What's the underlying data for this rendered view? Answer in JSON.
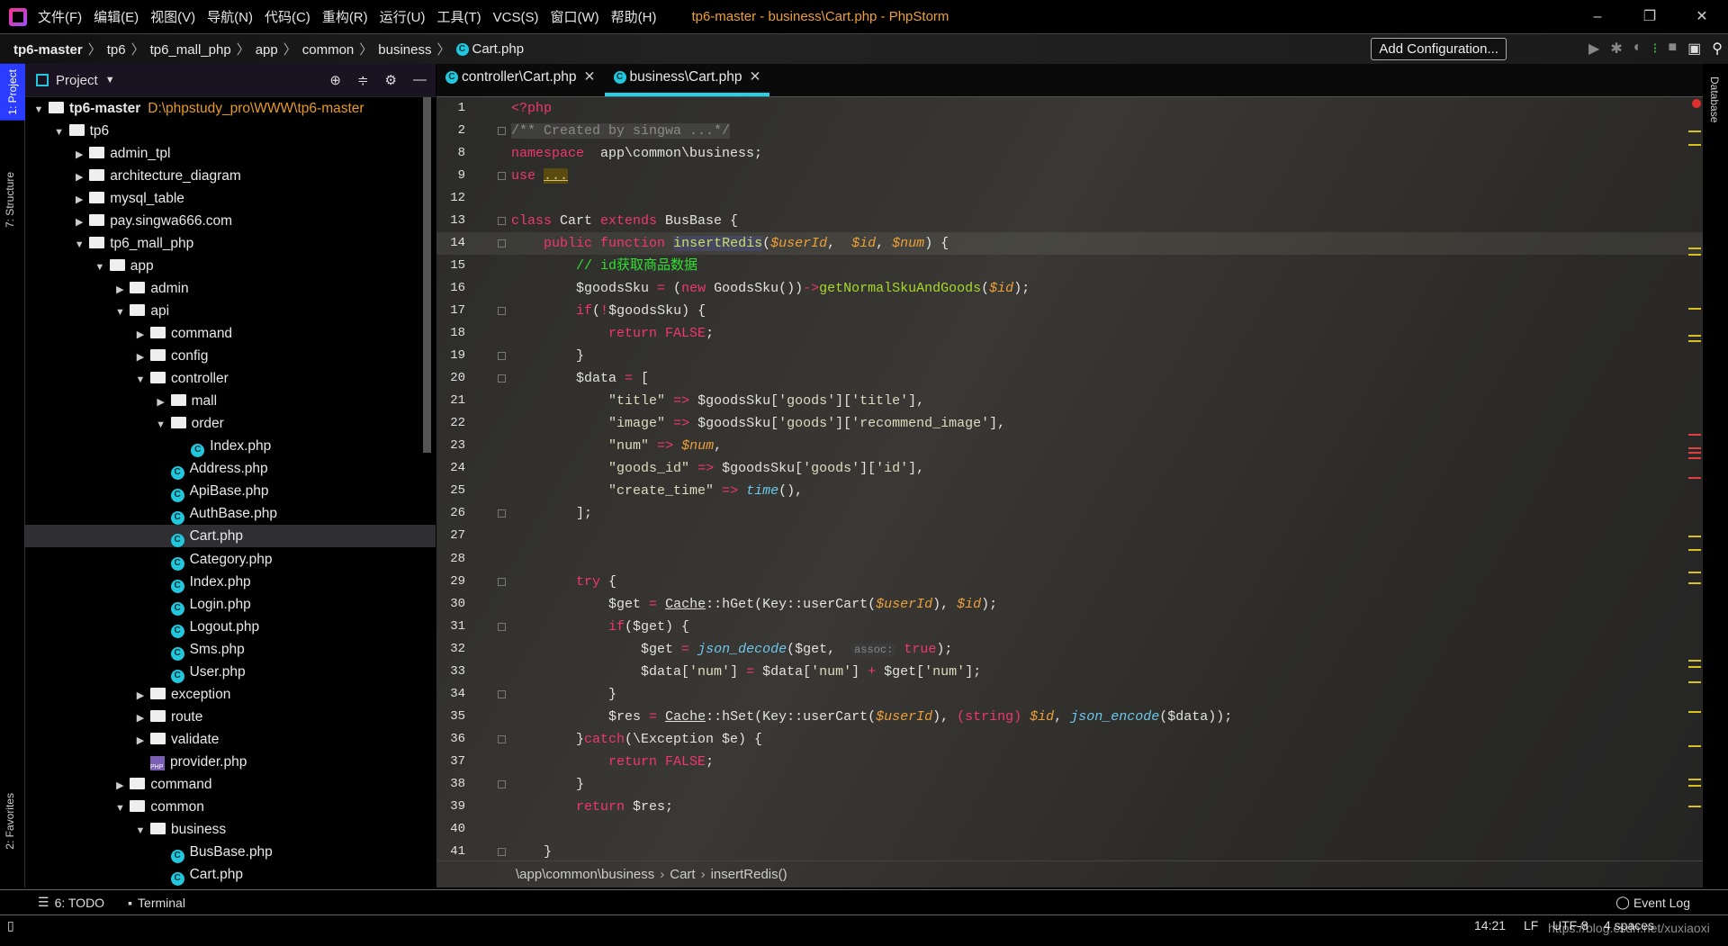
{
  "titlebar": {
    "menu": [
      "文件(F)",
      "编辑(E)",
      "视图(V)",
      "导航(N)",
      "代码(C)",
      "重构(R)",
      "运行(U)",
      "工具(T)",
      "VCS(S)",
      "窗口(W)",
      "帮助(H)"
    ],
    "title": "tp6-master - business\\Cart.php - PhpStorm"
  },
  "navbar": {
    "crumbs": [
      "tp6-master",
      "tp6",
      "tp6_mall_php",
      "app",
      "common",
      "business"
    ],
    "file": "Cart.php",
    "add_config": "Add Configuration..."
  },
  "side_tabs": {
    "project": "1: Project",
    "structure": "7: Structure",
    "favorites": "2: Favorites",
    "database": "Database"
  },
  "project": {
    "title": "Project",
    "root_path": "D:\\phpstudy_pro\\WWW\\tp6-master",
    "tree": [
      {
        "d": 0,
        "t": "folder",
        "open": true,
        "label": "tp6-master",
        "bold": true
      },
      {
        "d": 1,
        "t": "folder",
        "open": true,
        "label": "tp6"
      },
      {
        "d": 2,
        "t": "folder",
        "open": false,
        "label": "admin_tpl"
      },
      {
        "d": 2,
        "t": "folder",
        "open": false,
        "label": "architecture_diagram"
      },
      {
        "d": 2,
        "t": "folder",
        "open": false,
        "label": "mysql_table"
      },
      {
        "d": 2,
        "t": "folder",
        "open": false,
        "label": "pay.singwa666.com"
      },
      {
        "d": 2,
        "t": "folder",
        "open": true,
        "label": "tp6_mall_php"
      },
      {
        "d": 3,
        "t": "folder",
        "open": true,
        "label": "app"
      },
      {
        "d": 4,
        "t": "folder",
        "open": false,
        "label": "admin"
      },
      {
        "d": 4,
        "t": "folder",
        "open": true,
        "label": "api"
      },
      {
        "d": 5,
        "t": "folder",
        "open": false,
        "label": "command"
      },
      {
        "d": 5,
        "t": "folder",
        "open": false,
        "label": "config"
      },
      {
        "d": 5,
        "t": "folder",
        "open": true,
        "label": "controller"
      },
      {
        "d": 6,
        "t": "folder",
        "open": false,
        "label": "mall"
      },
      {
        "d": 6,
        "t": "folder",
        "open": true,
        "label": "order"
      },
      {
        "d": 7,
        "t": "class",
        "label": "Index.php"
      },
      {
        "d": 6,
        "t": "class",
        "label": "Address.php"
      },
      {
        "d": 6,
        "t": "class",
        "label": "ApiBase.php"
      },
      {
        "d": 6,
        "t": "class",
        "label": "AuthBase.php"
      },
      {
        "d": 6,
        "t": "class",
        "label": "Cart.php",
        "selected": true
      },
      {
        "d": 6,
        "t": "class",
        "label": "Category.php"
      },
      {
        "d": 6,
        "t": "class",
        "label": "Index.php"
      },
      {
        "d": 6,
        "t": "class",
        "label": "Login.php"
      },
      {
        "d": 6,
        "t": "class",
        "label": "Logout.php"
      },
      {
        "d": 6,
        "t": "class",
        "label": "Sms.php"
      },
      {
        "d": 6,
        "t": "class",
        "label": "User.php"
      },
      {
        "d": 5,
        "t": "folder",
        "open": false,
        "label": "exception"
      },
      {
        "d": 5,
        "t": "folder",
        "open": false,
        "label": "route"
      },
      {
        "d": 5,
        "t": "folder",
        "open": false,
        "label": "validate"
      },
      {
        "d": 5,
        "t": "php",
        "label": "provider.php"
      },
      {
        "d": 4,
        "t": "folder",
        "open": false,
        "label": "command"
      },
      {
        "d": 4,
        "t": "folder",
        "open": true,
        "label": "common"
      },
      {
        "d": 5,
        "t": "folder",
        "open": true,
        "label": "business"
      },
      {
        "d": 6,
        "t": "class",
        "label": "BusBase.php"
      },
      {
        "d": 6,
        "t": "class",
        "label": "Cart.php"
      }
    ]
  },
  "editor": {
    "tabs": [
      {
        "label": "controller\\Cart.php",
        "active": false
      },
      {
        "label": "business\\Cart.php",
        "active": true
      }
    ],
    "current_line": 14,
    "lines": [
      {
        "n": 1,
        "tk": [
          [
            "kw",
            "<?php"
          ]
        ]
      },
      {
        "n": 2,
        "tk": [
          [
            "doc",
            "/** Created by singwa ...*/"
          ]
        ]
      },
      {
        "n": 8,
        "tk": [
          [
            "kw",
            "namespace"
          ],
          [
            "",
            "  app\\common\\business;"
          ]
        ]
      },
      {
        "n": 9,
        "tk": [
          [
            "kw",
            "use "
          ],
          [
            "fold",
            "..."
          ]
        ]
      },
      {
        "n": 12,
        "tk": []
      },
      {
        "n": 13,
        "tk": [
          [
            "kw",
            "class"
          ],
          [
            "",
            " Cart "
          ],
          [
            "kw",
            "extends"
          ],
          [
            "",
            " BusBase {"
          ]
        ]
      },
      {
        "n": 14,
        "tk": [
          [
            "",
            "    "
          ],
          [
            "kw",
            "public function"
          ],
          [
            "",
            " "
          ],
          [
            "mname",
            "insertRedis"
          ],
          [
            "",
            "("
          ],
          [
            "var",
            "$userId"
          ],
          [
            "",
            ",  "
          ],
          [
            "var",
            "$id"
          ],
          [
            "",
            ", "
          ],
          [
            "var",
            "$num"
          ],
          [
            "",
            ") {"
          ]
        ]
      },
      {
        "n": 15,
        "tk": [
          [
            "",
            "        "
          ],
          [
            "cm",
            "// id获取商品数据"
          ]
        ]
      },
      {
        "n": 16,
        "tk": [
          [
            "",
            "        $goodsSku "
          ],
          [
            "op",
            "="
          ],
          [
            "",
            " ("
          ],
          [
            "kw",
            "new"
          ],
          [
            "",
            " GoodsSku())"
          ],
          [
            "op",
            "->"
          ],
          [
            "fn",
            "getNormalSkuAndGoods"
          ],
          [
            "",
            "("
          ],
          [
            "var",
            "$id"
          ],
          [
            "",
            ");"
          ]
        ]
      },
      {
        "n": 17,
        "tk": [
          [
            "",
            "        "
          ],
          [
            "kw",
            "if"
          ],
          [
            "",
            "("
          ],
          [
            "op",
            "!"
          ],
          [
            "",
            "$goodsSku) {"
          ]
        ]
      },
      {
        "n": 18,
        "tk": [
          [
            "",
            "            "
          ],
          [
            "kw",
            "return FALSE"
          ],
          [
            "",
            ";"
          ]
        ]
      },
      {
        "n": 19,
        "tk": [
          [
            "",
            "        }"
          ]
        ]
      },
      {
        "n": 20,
        "tk": [
          [
            "",
            "        $data "
          ],
          [
            "op",
            "="
          ],
          [
            "",
            " ["
          ]
        ]
      },
      {
        "n": 21,
        "tk": [
          [
            "",
            "            "
          ],
          [
            "str",
            "\"title\""
          ],
          [
            "",
            " "
          ],
          [
            "op",
            "=>"
          ],
          [
            "",
            " $goodsSku["
          ],
          [
            "str",
            "'goods'"
          ],
          [
            "",
            "]["
          ],
          [
            "str",
            "'title'"
          ],
          [
            "",
            "],"
          ]
        ]
      },
      {
        "n": 22,
        "tk": [
          [
            "",
            "            "
          ],
          [
            "str",
            "\"image\""
          ],
          [
            "",
            " "
          ],
          [
            "op",
            "=>"
          ],
          [
            "",
            " $goodsSku["
          ],
          [
            "str",
            "'goods'"
          ],
          [
            "",
            "]["
          ],
          [
            "str",
            "'recommend_image'"
          ],
          [
            "",
            "],"
          ]
        ]
      },
      {
        "n": 23,
        "tk": [
          [
            "",
            "            "
          ],
          [
            "str",
            "\"num\""
          ],
          [
            "",
            " "
          ],
          [
            "op",
            "=>"
          ],
          [
            "",
            " "
          ],
          [
            "var",
            "$num"
          ],
          [
            "",
            ","
          ]
        ]
      },
      {
        "n": 24,
        "tk": [
          [
            "",
            "            "
          ],
          [
            "str",
            "\"goods_id\""
          ],
          [
            "",
            " "
          ],
          [
            "op",
            "=>"
          ],
          [
            "",
            " $goodsSku["
          ],
          [
            "str",
            "'goods'"
          ],
          [
            "",
            "]["
          ],
          [
            "str",
            "'id'"
          ],
          [
            "",
            "],"
          ]
        ]
      },
      {
        "n": 25,
        "tk": [
          [
            "",
            "            "
          ],
          [
            "str",
            "\"create_time\""
          ],
          [
            "",
            " "
          ],
          [
            "op",
            "=>"
          ],
          [
            "",
            " "
          ],
          [
            "bi",
            "time"
          ],
          [
            "",
            "(),"
          ]
        ]
      },
      {
        "n": 26,
        "tk": [
          [
            "",
            "        ];"
          ]
        ]
      },
      {
        "n": 27,
        "tk": []
      },
      {
        "n": 28,
        "tk": []
      },
      {
        "n": 29,
        "tk": [
          [
            "",
            "        "
          ],
          [
            "kw",
            "try"
          ],
          [
            "",
            " {"
          ]
        ]
      },
      {
        "n": 30,
        "tk": [
          [
            "",
            "            $get "
          ],
          [
            "op",
            "="
          ],
          [
            "",
            " "
          ],
          [
            "cls",
            "Cache"
          ],
          [
            "",
            "::hGet(Key::userCart("
          ],
          [
            "var",
            "$userId"
          ],
          [
            "",
            "), "
          ],
          [
            "var",
            "$id"
          ],
          [
            "",
            ");"
          ]
        ]
      },
      {
        "n": 31,
        "tk": [
          [
            "",
            "            "
          ],
          [
            "kw",
            "if"
          ],
          [
            "",
            "($get) {"
          ]
        ]
      },
      {
        "n": 32,
        "tk": [
          [
            "",
            "                $get "
          ],
          [
            "op",
            "="
          ],
          [
            "",
            " "
          ],
          [
            "bi",
            "json_decode"
          ],
          [
            "",
            "($get,  "
          ],
          [
            "hint",
            "assoc:"
          ],
          [
            "",
            " "
          ],
          [
            "kw",
            "true"
          ],
          [
            "",
            ");"
          ]
        ]
      },
      {
        "n": 33,
        "tk": [
          [
            "",
            "                $data["
          ],
          [
            "str",
            "'num'"
          ],
          [
            "",
            "] "
          ],
          [
            "op",
            "="
          ],
          [
            "",
            " $data["
          ],
          [
            "str",
            "'num'"
          ],
          [
            "",
            "] "
          ],
          [
            "op",
            "+"
          ],
          [
            "",
            " $get["
          ],
          [
            "str",
            "'num'"
          ],
          [
            "",
            "];"
          ]
        ]
      },
      {
        "n": 34,
        "tk": [
          [
            "",
            "            }"
          ]
        ]
      },
      {
        "n": 35,
        "tk": [
          [
            "",
            "            $res "
          ],
          [
            "op",
            "="
          ],
          [
            "",
            " "
          ],
          [
            "cls",
            "Cache"
          ],
          [
            "",
            "::hSet(Key::userCart("
          ],
          [
            "var",
            "$userId"
          ],
          [
            "",
            "), "
          ],
          [
            "op",
            "(string)"
          ],
          [
            "",
            " "
          ],
          [
            "var",
            "$id"
          ],
          [
            "",
            ", "
          ],
          [
            "bi",
            "json_encode"
          ],
          [
            "",
            "($data));"
          ]
        ]
      },
      {
        "n": 36,
        "tk": [
          [
            "",
            "        }"
          ],
          [
            "kw",
            "catch"
          ],
          [
            "",
            "(\\Exception $e) {"
          ]
        ]
      },
      {
        "n": 37,
        "tk": [
          [
            "",
            "            "
          ],
          [
            "kw",
            "return FALSE"
          ],
          [
            "",
            ";"
          ]
        ]
      },
      {
        "n": 38,
        "tk": [
          [
            "",
            "        }"
          ]
        ]
      },
      {
        "n": 39,
        "tk": [
          [
            "",
            "        "
          ],
          [
            "kw",
            "return"
          ],
          [
            "",
            " $res;"
          ]
        ]
      },
      {
        "n": 40,
        "tk": []
      },
      {
        "n": 41,
        "tk": [
          [
            "",
            "    }"
          ]
        ]
      }
    ],
    "breadcrumb": [
      "\\app\\common\\business",
      "Cart",
      "insertRedis()"
    ]
  },
  "bottombar": {
    "todo": "6: TODO",
    "terminal": "Terminal",
    "event_log": "Event Log"
  },
  "status": {
    "position": "14:21",
    "line_sep": "LF",
    "encoding": "UTF-8",
    "indent": "4 spaces",
    "watermark": "https://blog.csdn.net/xuxiaoxi"
  },
  "colors": {
    "accent": "#22d2e8",
    "keyword": "#f0376e",
    "variable": "#eca03a",
    "comment": "#30e030"
  }
}
